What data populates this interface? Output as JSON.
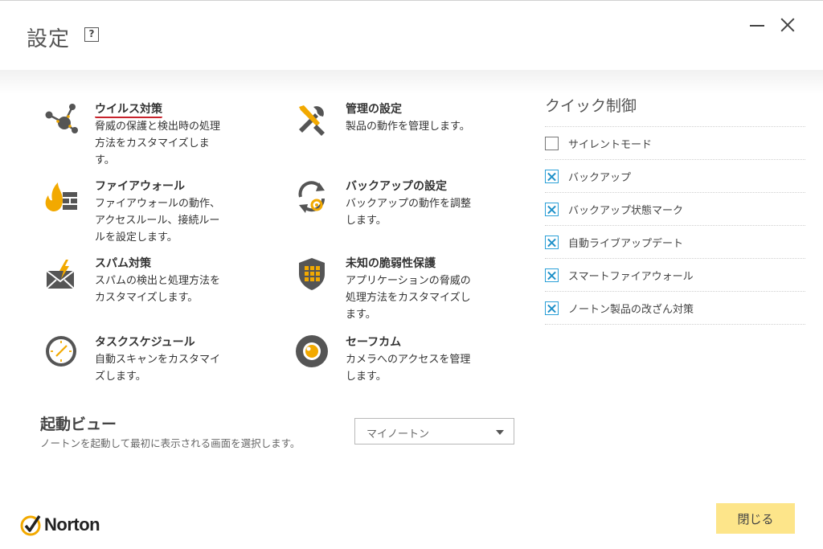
{
  "header": {
    "title": "設定",
    "help_label": "?"
  },
  "categories": [
    {
      "title": "ウイルス対策",
      "desc": "脅威の保護と検出時の処理方法をカスタマイズします。",
      "icon": "virus-protection-icon"
    },
    {
      "title": "管理の設定",
      "desc": "製品の動作を管理します。",
      "icon": "tools-icon"
    },
    {
      "title": "ファイアウォール",
      "desc": "ファイアウォールの動作、アクセスルール、接続ルールを設定します。",
      "icon": "firewall-icon"
    },
    {
      "title": "バックアップの設定",
      "desc": "バックアップの動作を調整します。",
      "icon": "backup-icon"
    },
    {
      "title": "スパム対策",
      "desc": "スパムの検出と処理方法をカスタマイズします。",
      "icon": "spam-mail-icon"
    },
    {
      "title": "未知の脆弱性保護",
      "desc": "アプリケーションの脅威の処理方法をカスタマイズします。",
      "icon": "shield-icon"
    },
    {
      "title": "タスクスケジュール",
      "desc": "自動スキャンをカスタマイズします。",
      "icon": "clock-icon"
    },
    {
      "title": "セーフカム",
      "desc": "カメラへのアクセスを管理します。",
      "icon": "camera-icon"
    }
  ],
  "quick_control": {
    "title": "クイック制御",
    "items": [
      {
        "label": "サイレントモード",
        "checked": false
      },
      {
        "label": "バックアップ",
        "checked": true
      },
      {
        "label": "バックアップ状態マーク",
        "checked": true
      },
      {
        "label": "自動ライブアップデート",
        "checked": true
      },
      {
        "label": "スマートファイアウォール",
        "checked": true
      },
      {
        "label": "ノートン製品の改ざん対策",
        "checked": true
      }
    ]
  },
  "startup": {
    "title": "起動ビュー",
    "desc": "ノートンを起動して最初に表示される画面を選択します。",
    "selected": "マイノートン"
  },
  "footer": {
    "logo_text": "Norton",
    "close_label": "閉じる"
  },
  "colors": {
    "icon_gray": "#555555",
    "icon_accent": "#f2a900",
    "close_button": "#fde58a",
    "checkbox_accent": "#1e90c8",
    "active_underline": "#c8232c"
  }
}
